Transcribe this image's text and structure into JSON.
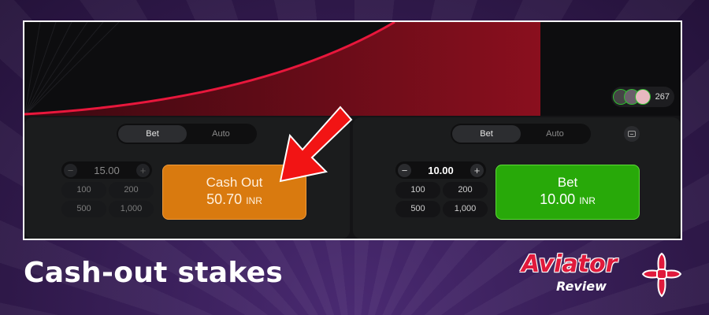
{
  "players": {
    "count": "267"
  },
  "left_panel": {
    "tabs": [
      {
        "label": "Bet"
      },
      {
        "label": "Auto"
      }
    ],
    "stake": {
      "value": "15.00",
      "minus": "−",
      "plus": "+"
    },
    "quick_amounts": [
      "100",
      "200",
      "500",
      "1,000"
    ],
    "action": {
      "label": "Cash Out",
      "amount": "50.70",
      "currency": "INR"
    }
  },
  "right_panel": {
    "tabs": [
      {
        "label": "Bet"
      },
      {
        "label": "Auto"
      }
    ],
    "stake": {
      "value": "10.00",
      "minus": "−",
      "plus": "+"
    },
    "quick_amounts": [
      "100",
      "200",
      "500",
      "1,000"
    ],
    "action": {
      "label": "Bet",
      "amount": "10.00",
      "currency": "INR"
    }
  },
  "caption": "Cash-out stakes",
  "logo": {
    "word": "Aviator",
    "sub": "Review"
  },
  "colors": {
    "cashout": "#d97a0f",
    "bet": "#28a909",
    "curve": "#e8173c",
    "arrow": "#f21414"
  }
}
